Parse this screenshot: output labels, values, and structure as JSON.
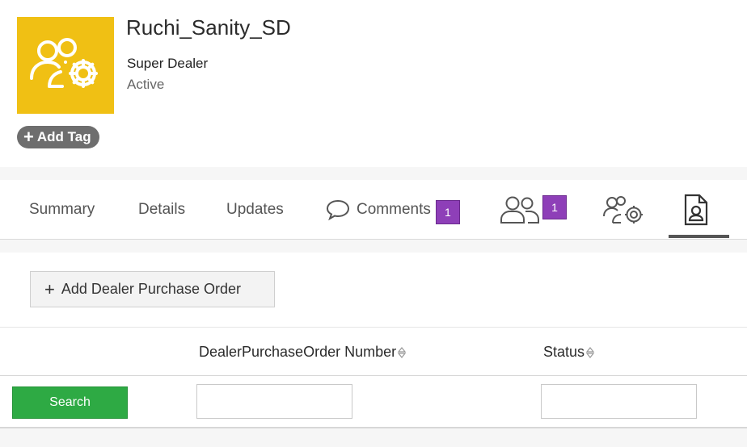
{
  "profile": {
    "name": "Ruchi_Sanity_SD",
    "role": "Super Dealer",
    "status": "Active",
    "add_tag_label": "Add Tag",
    "avatar_color": "#f0c014",
    "avatar_icon": "users-gear-icon"
  },
  "tabs": {
    "summary": "Summary",
    "details": "Details",
    "updates": "Updates",
    "comments": "Comments",
    "comments_count": "1",
    "contacts_count": "1"
  },
  "actions": {
    "add_dpo_label": "Add Dealer Purchase Order"
  },
  "table": {
    "col_number": "DealerPurchaseOrder Number",
    "col_status": "Status",
    "search_label": "Search",
    "number_filter_value": "",
    "status_filter_value": ""
  },
  "colors": {
    "badge": "#8e3fb8",
    "search_button": "#2eaa44"
  }
}
